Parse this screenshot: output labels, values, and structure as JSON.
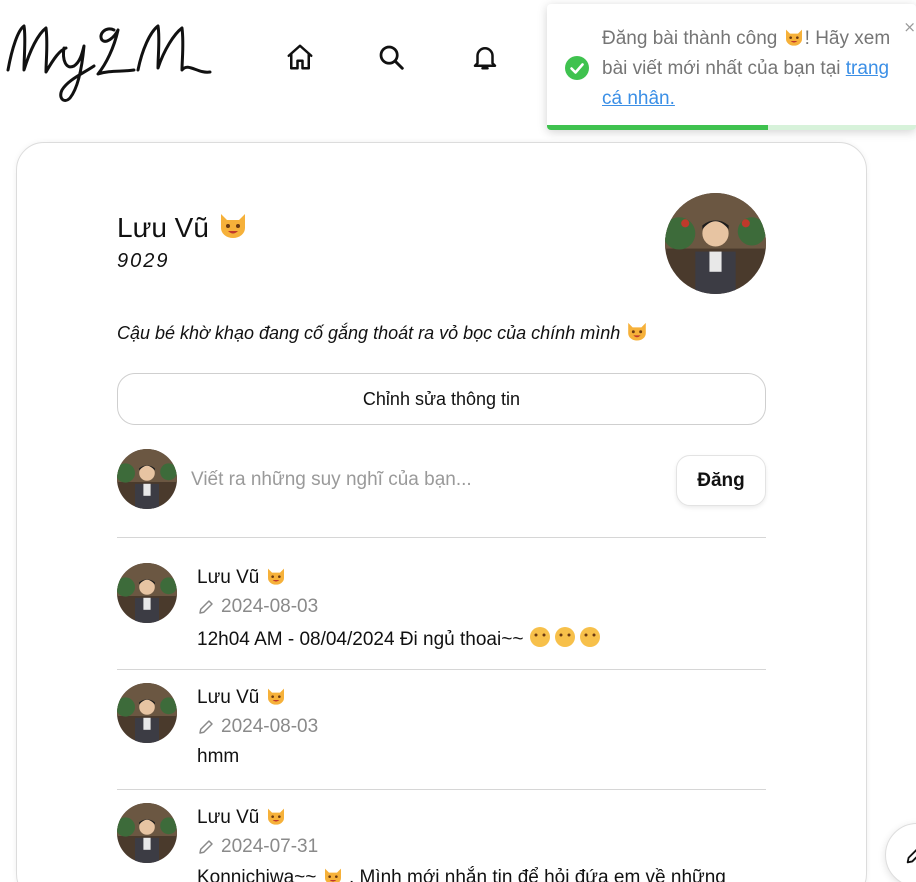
{
  "logo": {
    "text": "MyLM"
  },
  "nav": {
    "home_icon": "home-icon",
    "search_icon": "search-icon",
    "notifications_icon": "bell-icon"
  },
  "toast": {
    "message_part1": "Đăng bài thành công",
    "message_part2": "! Hãy xem bài viết mới nhất của bạn tại",
    "link_text": "trang cá nhân.",
    "close": "×",
    "progress": 0.6
  },
  "profile": {
    "name": "Lưu Vũ",
    "username": "9029",
    "bio": "Cậu bé khờ khạo đang cố gắng thoát ra vỏ bọc của chính mình",
    "edit_button": "Chỉnh sửa thông tin"
  },
  "compose": {
    "placeholder": "Viết ra những suy nghĩ của bạn...",
    "post_button": "Đăng"
  },
  "posts": [
    {
      "author": "Lưu Vũ",
      "date": "2024-08-03",
      "text": "12h04 AM - 08/04/2024 Đi ngủ thoai~~"
    },
    {
      "author": "Lưu Vũ",
      "date": "2024-08-03",
      "text": "hmm"
    },
    {
      "author": "Lưu Vũ",
      "date": "2024-07-31",
      "text_a": "Konnichiwa~~",
      "text_b": ". Mình mới nhắn tin để hỏi đứa em về những"
    }
  ],
  "colors": {
    "toast_success": "#3fc24f",
    "link": "#3b8fe6",
    "muted_text": "#8a8a8a"
  }
}
